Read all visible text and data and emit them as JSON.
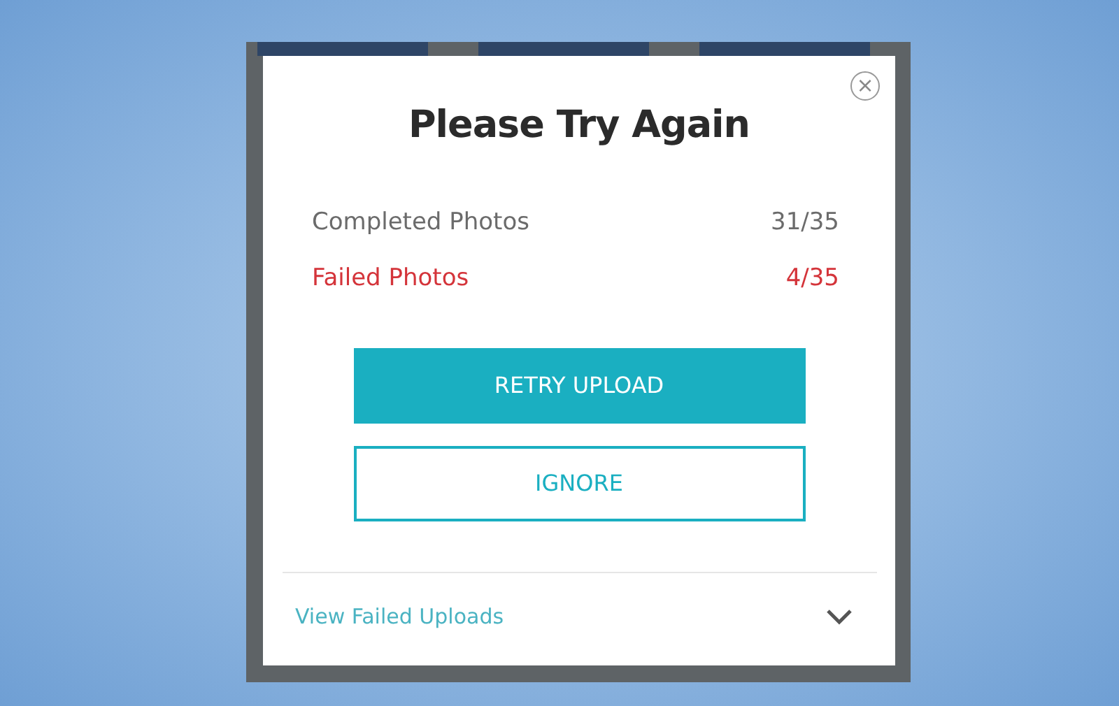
{
  "dialog": {
    "title": "Please Try Again",
    "close": "×",
    "stats": [
      {
        "kind": "normal",
        "label": "Completed Photos",
        "value": "31/35"
      },
      {
        "kind": "failed",
        "label": "Failed Photos",
        "value": "4/35"
      }
    ],
    "buttons": [
      {
        "kind": "primary",
        "label": "RETRY UPLOAD"
      },
      {
        "kind": "outline",
        "label": "IGNORE"
      }
    ],
    "footer": {
      "label": "View Failed Uploads",
      "expanded": false
    }
  }
}
